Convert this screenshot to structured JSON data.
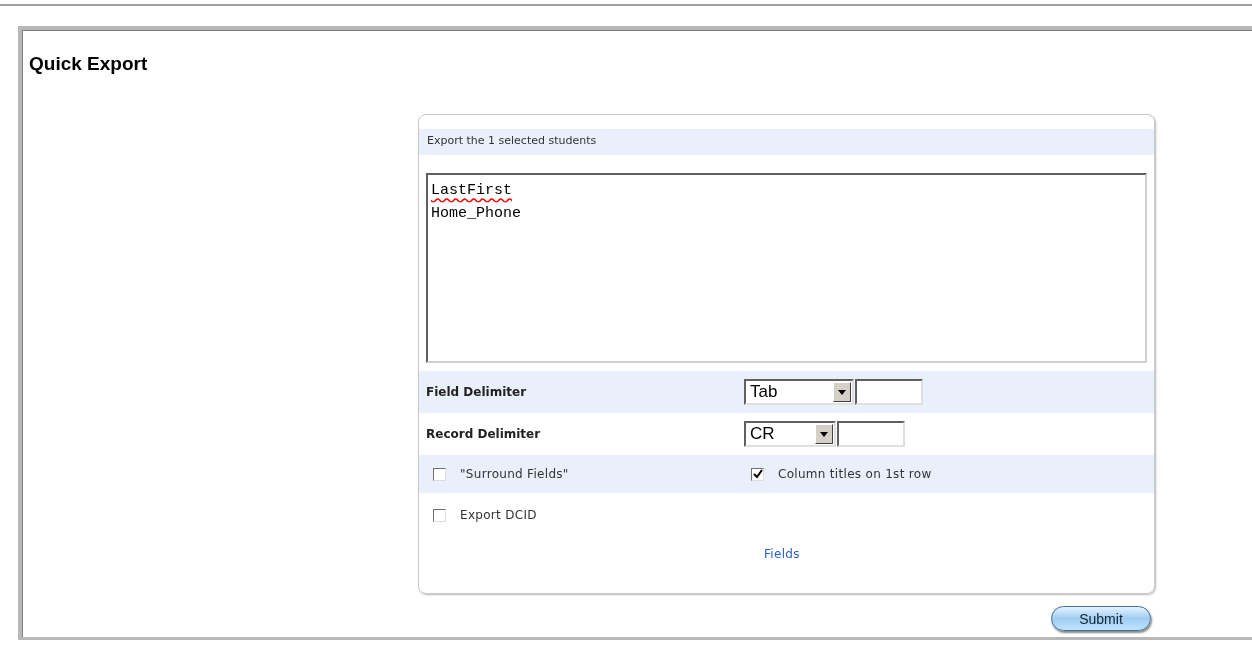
{
  "page_title": "Quick Export",
  "panel": {
    "heading": "Export the 1 selected students",
    "fields_text": {
      "lines": [
        "LastFirst",
        "Home_Phone"
      ]
    },
    "delimiters": [
      {
        "label": "Field Delimiter",
        "value": "Tab"
      },
      {
        "label": "Record Delimiter",
        "value": "CR"
      }
    ],
    "options": [
      {
        "label": "\"Surround Fields\"",
        "checked": false
      },
      {
        "label": "Column titles on 1st row",
        "checked": true
      },
      {
        "label": "Export DCID",
        "checked": false
      }
    ],
    "link": "Fields"
  },
  "submit": "Submit"
}
